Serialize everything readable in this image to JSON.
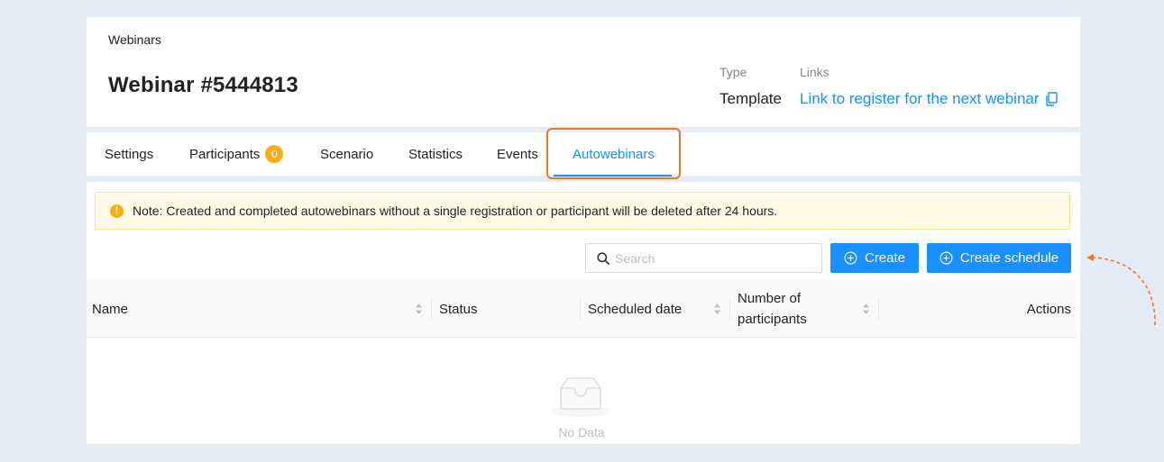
{
  "header": {
    "breadcrumb": "Webinars",
    "title": "Webinar #5444813",
    "type_label": "Type",
    "type_value": "Template",
    "links_label": "Links",
    "links_value": "Link to register for the next webinar"
  },
  "tabs": [
    {
      "label": "Settings"
    },
    {
      "label": "Participants",
      "badge": "0"
    },
    {
      "label": "Scenario"
    },
    {
      "label": "Statistics"
    },
    {
      "label": "Events"
    },
    {
      "label": "Autowebinars",
      "active": true
    }
  ],
  "alert": {
    "text": "Note: Created and completed autowebinars without a single registration or participant will be deleted after 24 hours."
  },
  "toolbar": {
    "search_placeholder": "Search",
    "create_label": "Create",
    "create_schedule_label": "Create schedule"
  },
  "table": {
    "columns": {
      "name": "Name",
      "status": "Status",
      "scheduled_date": "Scheduled date",
      "participants_line1": "Number of",
      "participants_line2": "participants",
      "actions": "Actions"
    },
    "empty_text": "No Data"
  },
  "colors": {
    "accent": "#1890ff",
    "badge": "#faad14",
    "highlight": "#e8782c",
    "background": "#e4ebf4"
  }
}
